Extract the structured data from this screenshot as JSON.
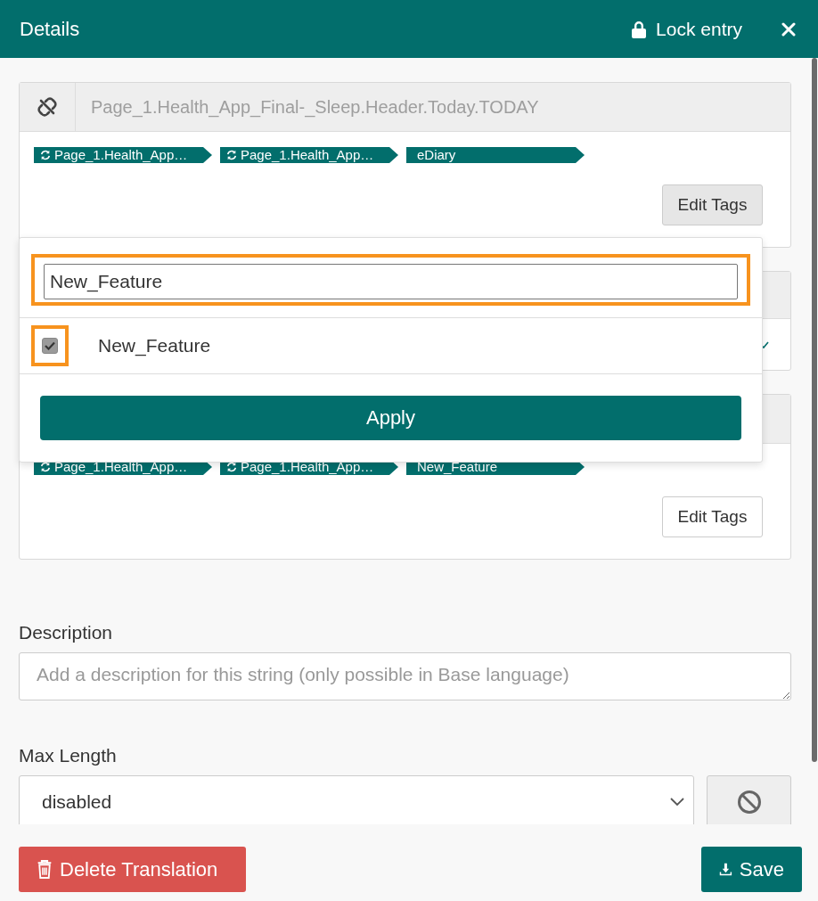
{
  "header": {
    "title": "Details",
    "lock_label": "Lock entry"
  },
  "cards": [
    {
      "kind": "full",
      "key_placeholder": "Page_1.Health_App_Final-_Sleep.Header.Today.TODAY",
      "tags": [
        {
          "kind": "linked",
          "label": "Page_1.Health_App…"
        },
        {
          "kind": "linked",
          "label": "Page_1.Health_App…"
        },
        {
          "kind": "plain",
          "label": "eDiary"
        }
      ],
      "edit_button": {
        "label": "Edit Tags",
        "active": true
      }
    },
    {
      "kind": "covered"
    },
    {
      "kind": "head_covered",
      "tags": [
        {
          "kind": "linked",
          "label": "Page_1.Health_App…"
        },
        {
          "kind": "linked",
          "label": "Page_1.Health_App…"
        },
        {
          "kind": "plain",
          "label": "New_Feature"
        }
      ],
      "edit_button": {
        "label": "Edit Tags",
        "active": false
      }
    }
  ],
  "tag_dropdown": {
    "search": {
      "value": "New_Feature",
      "highlighted": true
    },
    "options": [
      {
        "label": "New_Feature",
        "checked": true,
        "highlighted": true
      }
    ],
    "apply": "Apply"
  },
  "description": {
    "label": "Description",
    "placeholder": "Add a description for this string (only possible in Base language)"
  },
  "max_length": {
    "label": "Max Length",
    "value": "disabled"
  },
  "footer": {
    "delete": "Delete Translation",
    "save": "Save"
  }
}
